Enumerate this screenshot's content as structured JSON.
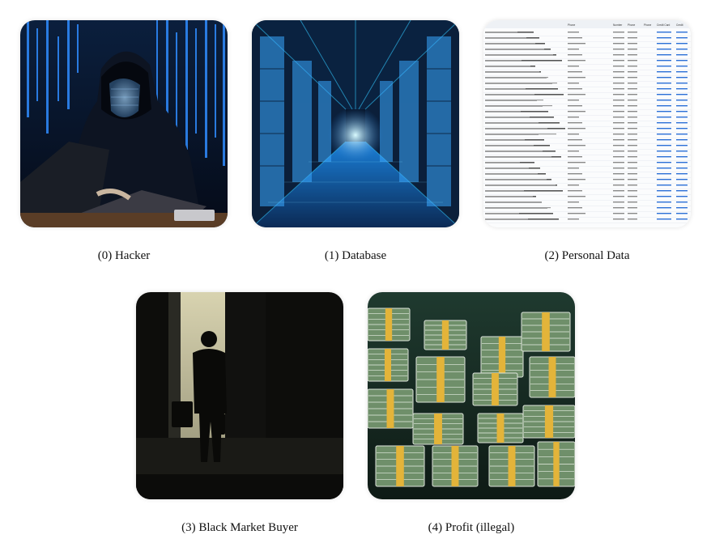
{
  "items": [
    {
      "index": "(0)",
      "label": "Hacker",
      "caption": "(0) Hacker"
    },
    {
      "index": "(1)",
      "label": "Database",
      "caption": "(1) Database"
    },
    {
      "index": "(2)",
      "label": "Personal Data",
      "caption": "(2) Personal Data"
    },
    {
      "index": "(3)",
      "label": "Black Market Buyer",
      "caption": "(3) Black Market Buyer"
    },
    {
      "index": "(4)",
      "label": "Profit (illegal)",
      "caption": "(4) Profit (illegal)"
    }
  ],
  "personal_data_table": {
    "headers": [
      "Phone",
      "Number",
      "Phone",
      "Phone",
      "Credit Card",
      "Credit"
    ]
  },
  "colors": {
    "hacker_bg": "#0a1a33",
    "code_blue": "#2f8cff",
    "server_glow": "#33c8ff",
    "link_blue": "#2b6fd6",
    "money_green": "#6f8f6a",
    "money_band": "#e3b43a"
  }
}
